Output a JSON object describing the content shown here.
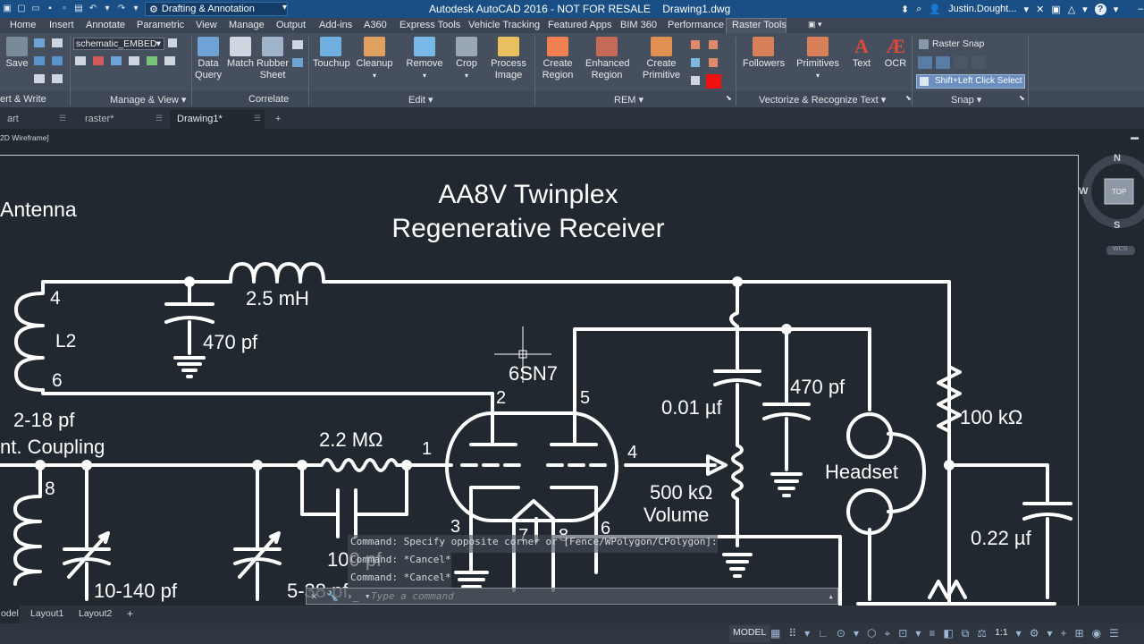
{
  "window": {
    "title": "Autodesk AutoCAD 2016 - NOT FOR RESALE",
    "document": "Drawing1.dwg",
    "workspace": "Drafting & Annotation",
    "user": "Justin.Dought...",
    "min": "–",
    "max": "□"
  },
  "menu": [
    "Home",
    "Insert",
    "Annotate",
    "Parametric",
    "View",
    "Manage",
    "Output",
    "Add-ins",
    "A360",
    "Express Tools",
    "Vehicle Tracking",
    "Featured Apps",
    "BIM 360",
    "Performance",
    "Raster Tools"
  ],
  "ribbon": {
    "save": "Save",
    "combo": "schematic_EMBED",
    "buttons": [
      "Data\nQuery",
      "Match",
      "Rubber\nSheet",
      "Touchup",
      "Cleanup",
      "Remove",
      "Crop",
      "Process\nImage",
      "Create\nRegion",
      "Enhanced\nRegion",
      "Create\nPrimitive",
      "Followers",
      "Primitives",
      "Text",
      "OCR"
    ],
    "raster_snap": "Raster Snap",
    "shift_select": "Shift+Left Click Select",
    "groups": [
      "ert & Write",
      "Manage & View ▾",
      "Correlate",
      "Edit ▾",
      "REM ▾",
      "Vectorize & Recognize Text ▾",
      "Snap ▾"
    ]
  },
  "doctabs": [
    "art",
    "raster*",
    "Drawing1*",
    "+"
  ],
  "viewport": {
    "label": "2D Wireframe]"
  },
  "viewcube": {
    "n": "N",
    "s": "S",
    "w": "W",
    "top": "TOP",
    "wcs": "WCS"
  },
  "schematic": {
    "title1": "AA8V Twinplex",
    "title2": "Regenerative Receiver",
    "antenna": "Antenna",
    "l2": "L2",
    "p4": "4",
    "p6": "6",
    "p8": "8",
    "ind": "2.5 mH",
    "c470a": "470 pf",
    "tube": "6SN7",
    "pin2": "2",
    "pin5": "5",
    "pin1": "1",
    "pin4": "4",
    "pin3": "3",
    "pin6": "6",
    "pin7": "7",
    "pin8": "8",
    "c001": "0.01 µf",
    "c470b": "470 pf",
    "r100k": "100 kΩ",
    "c218": "2-18 pf",
    "antcoup": "nt. Coupling",
    "r22m": "2.2 MΩ",
    "r500k": "500 kΩ",
    "volume": "Volume",
    "headset": "Headset",
    "c022": "0.22 µf",
    "c10140": "10-140 pf",
    "c100": "100 pf",
    "c538": "5-38 pf"
  },
  "command": {
    "lines": [
      "Command: Specify opposite corner or [Fence/WPolygon/CPolygon]:",
      "Command: *Cancel*",
      "Command: *Cancel*"
    ],
    "placeholder": "Type a command"
  },
  "layouts": [
    "odel",
    "Layout1",
    "Layout2",
    "+"
  ],
  "status": {
    "model": "MODEL",
    "scale": "1:1"
  }
}
